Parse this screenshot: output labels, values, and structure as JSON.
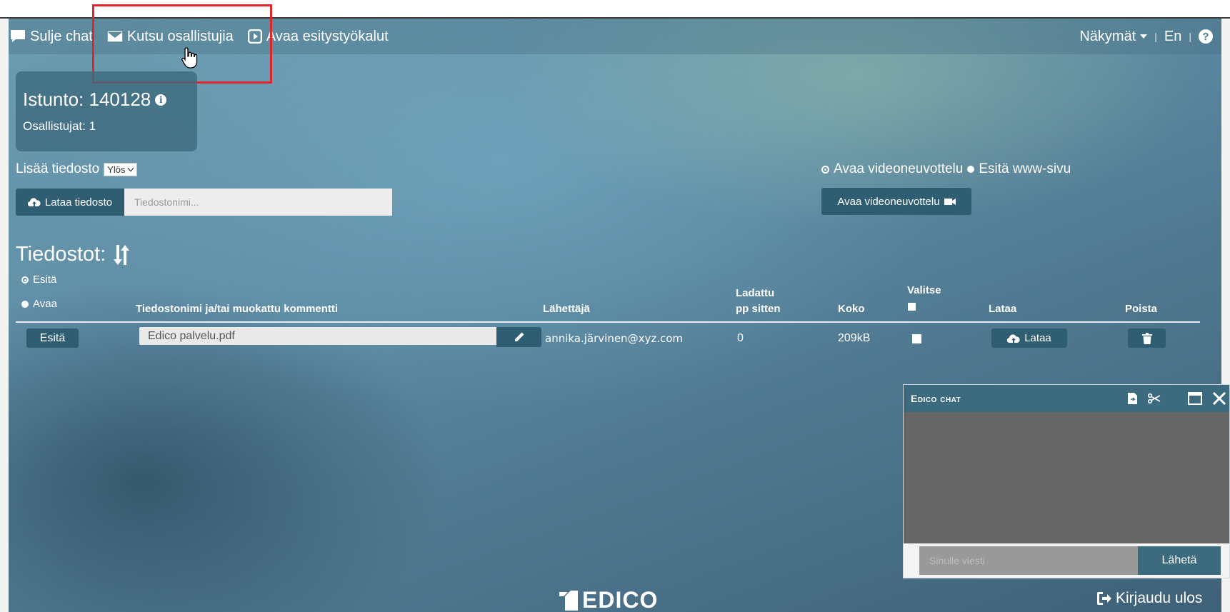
{
  "toolbar": {
    "close_chat": "Sulje chat",
    "invite": "Kutsu osallistujia",
    "open_tools": "Avaa esitystyökalut",
    "views": "Näkymät",
    "sep1": "|",
    "lang": "En",
    "sep2": "|",
    "help": "?"
  },
  "session": {
    "title": "Istunto: 140128",
    "participants": "Osallistujat: 1"
  },
  "upload": {
    "add_file_label": "Lisää tiedosto",
    "direction": "Ylös",
    "upload_button": "Lataa tiedosto",
    "filename_placeholder": "Tiedostonimi..."
  },
  "video": {
    "option_open": "Avaa videoneuvottelu",
    "option_present": "Esitä www-sivu",
    "button": "Avaa videoneuvottelu"
  },
  "files": {
    "heading": "Tiedostot:",
    "radio_present": "Esitä",
    "radio_open": "Avaa",
    "columns": {
      "filename": "Tiedostonimi ja/tai muokattu kommentti",
      "sender": "Lähettäjä",
      "uploaded_1": "Ladattu",
      "uploaded_2": "pp sitten",
      "size": "Koko",
      "select": "Valitse",
      "download": "Lataa",
      "delete": "Poista"
    },
    "rows": [
      {
        "action": "Esitä",
        "filename": "Edico palvelu.pdf",
        "sender": "annika.järvinen@xyz.com",
        "days": "0",
        "size": "209kB",
        "download": "Lataa"
      }
    ]
  },
  "chat": {
    "title": "Edico chat",
    "input_placeholder": "Sinulle viesti",
    "send": "Lähetä"
  },
  "footer": {
    "logo": "EDICO",
    "logout": "Kirjaudu ulos"
  }
}
